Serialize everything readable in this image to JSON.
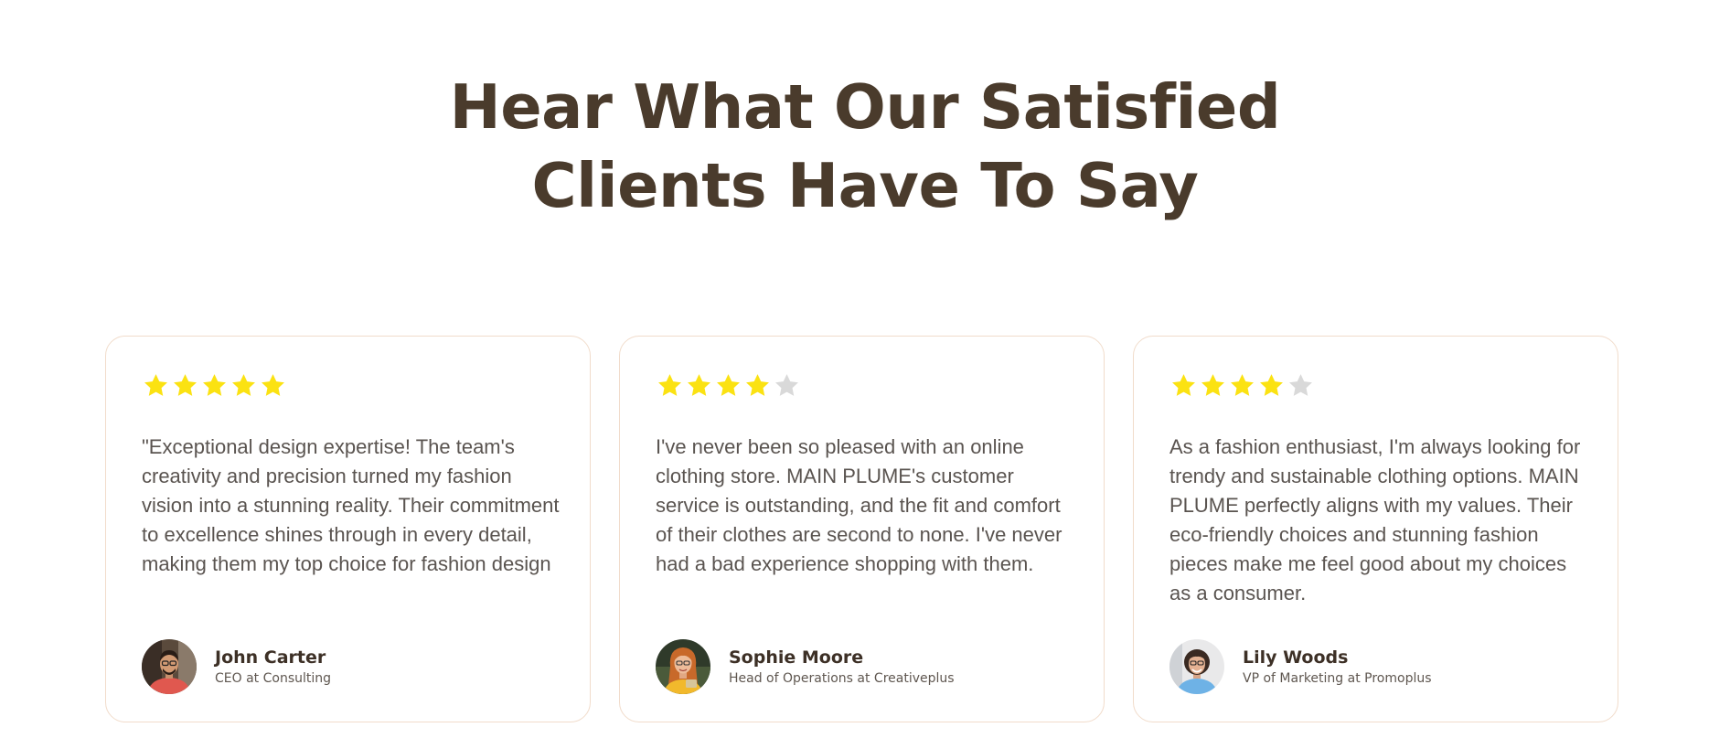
{
  "section": {
    "title_line1": "Hear What Our Satisfied",
    "title_line2": "Clients Have To Say"
  },
  "colors": {
    "heading": "#4a3b2c",
    "star_filled": "#fbe212",
    "star_empty": "#d9d9d9",
    "card_border": "#f1dccb",
    "body_text": "#5a5450"
  },
  "testimonials": [
    {
      "rating": 5,
      "rating_max": 5,
      "quote": "\"Exceptional design expertise! The team's creativity and precision turned my fashion vision into a stunning reality. Their commitment to excellence shines through in every detail, making them my top choice for fashion design",
      "name": "John Carter",
      "role": "CEO at Consulting",
      "avatar_icon": "avatar-man-red-shirt-icon"
    },
    {
      "rating": 4,
      "rating_max": 5,
      "quote": "I've never been so pleased with an online clothing store. MAIN PLUME's customer service is outstanding, and the fit and comfort of their clothes are second to none. I've never had a bad experience shopping with them.",
      "name": "Sophie Moore",
      "role": "Head of Operations at Creativeplus",
      "avatar_icon": "avatar-woman-yellow-top-icon"
    },
    {
      "rating": 4,
      "rating_max": 5,
      "quote": "As a fashion enthusiast, I'm always looking for trendy and sustainable clothing options. MAIN PLUME perfectly aligns with my values. Their eco-friendly choices and stunning fashion pieces make me feel good about my choices as a consumer.",
      "name": "Lily Woods",
      "role": "VP of Marketing at Promoplus",
      "avatar_icon": "avatar-woman-blue-top-icon"
    }
  ]
}
